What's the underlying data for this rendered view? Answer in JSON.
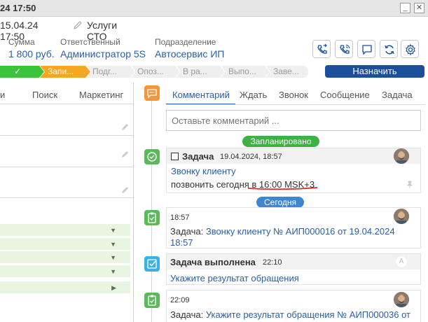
{
  "window": {
    "title": "24 17:50",
    "btn_min": "_",
    "btn_close": "✕"
  },
  "header": {
    "date": "15.04.24 17:50",
    "service": "Услуги СТО"
  },
  "fields": {
    "sum_label": "Сумма",
    "sum_value": "1 800 руб.",
    "resp_label": "Ответственный",
    "resp_value": "Администратор 5S",
    "dept_label": "Подразделение",
    "dept_value": "Автосервис ИП"
  },
  "stages": [
    "✓",
    "Запи...",
    "Подг...",
    "Опоз...",
    "В ра...",
    "Выпо...",
    "Заве..."
  ],
  "assign_button": "Назначить",
  "left_tabs": [
    "и",
    "Поиск",
    "Маркетинг"
  ],
  "right_tabs": [
    "Комментарий",
    "Ждать",
    "Звонок",
    "Сообщение",
    "Задача"
  ],
  "comment_placeholder": "Оставьте комментарий ...",
  "pills": {
    "planned": "Запланировано",
    "today": "Сегодня"
  },
  "card1": {
    "title": "Задача",
    "date": "19.04.2024, 18:57",
    "link": "Звонку клиенту",
    "text_prefix": "позвонить сегодня в ",
    "text_highlight": "16:00 MSK+3"
  },
  "card2": {
    "time": "18:57",
    "prefix": "Задача: ",
    "link": "Звонку клиенту № АИП000016 от 19.04.2024",
    "link2": "18:57"
  },
  "card3": {
    "title": "Задача выполнена",
    "time": "22:10",
    "link": "Укажите результат обращения",
    "badge": "A"
  },
  "card4": {
    "time": "22:09",
    "prefix": "Задача: ",
    "link": "Укажите результат обращения № АИП000036 от"
  },
  "colors": {
    "accent_blue": "#1b4f9c",
    "stage_green": "#3cc33c",
    "stage_orange": "#f5a623",
    "pill_green": "#3fb043",
    "pill_blue": "#3f86d0",
    "comment_icon": "#f0963c",
    "task_icon_green": "#5cb85c",
    "done_icon": "#3ab0e6"
  }
}
